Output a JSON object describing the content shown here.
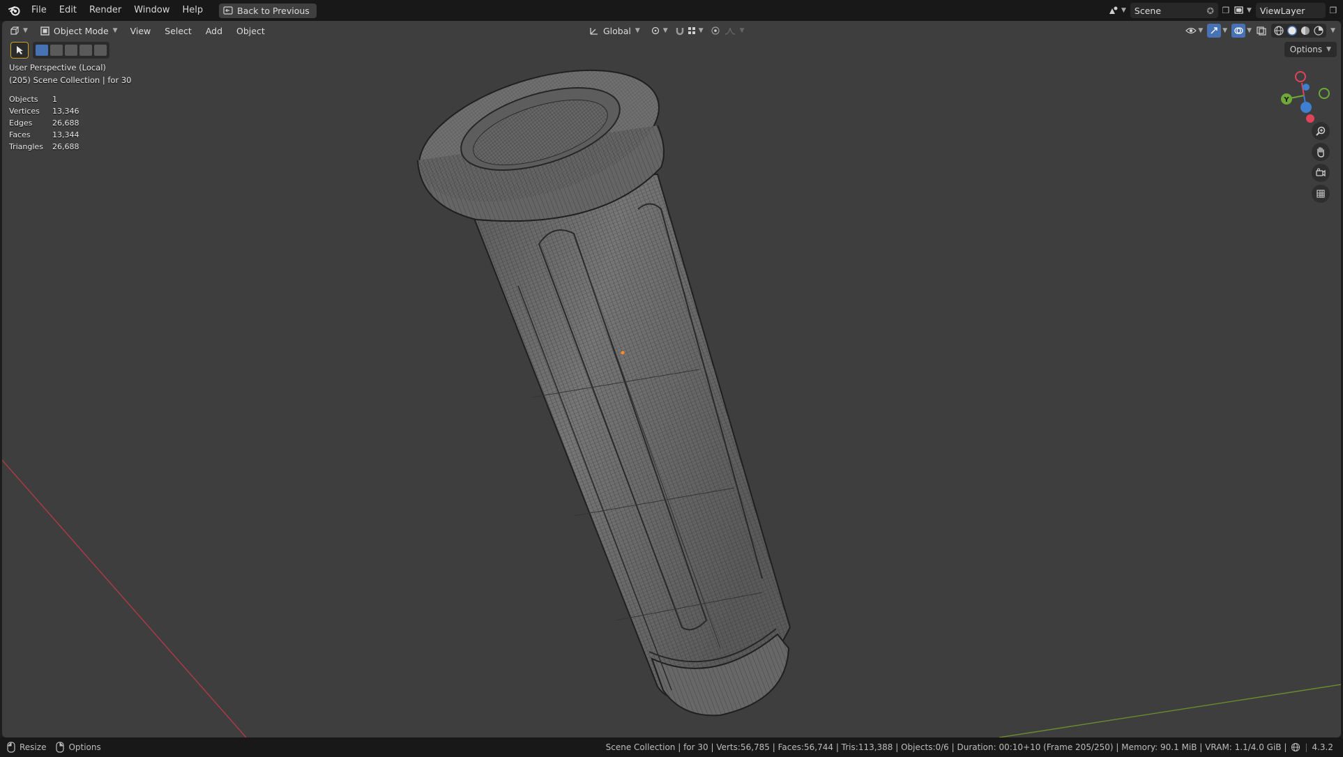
{
  "menu": {
    "items": [
      "File",
      "Edit",
      "Render",
      "Window",
      "Help"
    ],
    "back_button": "Back to Previous"
  },
  "workspace": {
    "scene_name": "Scene",
    "view_layer": "ViewLayer"
  },
  "viewport_header": {
    "mode": "Object Mode",
    "menus": [
      "View",
      "Select",
      "Add",
      "Object"
    ],
    "orientation": "Global",
    "options_label": "Options"
  },
  "overlay": {
    "perspective": "User Perspective (Local)",
    "collection": "(205) Scene Collection | for 30",
    "stats": [
      {
        "label": "Objects",
        "value": "1"
      },
      {
        "label": "Vertices",
        "value": "13,346"
      },
      {
        "label": "Edges",
        "value": "26,688"
      },
      {
        "label": "Faces",
        "value": "13,344"
      },
      {
        "label": "Triangles",
        "value": "26,688"
      }
    ]
  },
  "gizmo": {
    "x_color": "#e0445a",
    "y_color": "#6fa93a",
    "z_color": "#3f7fd0",
    "y_label": "Y"
  },
  "statusbar": {
    "left_resize": "Resize",
    "left_options": "Options",
    "info": "Scene Collection | for 30 | Verts:56,785 | Faces:56,744 | Tris:113,388 | Objects:0/6 | Duration: 00:10+10 (Frame 205/250) | Memory: 90.1 MiB | VRAM: 1.1/4.0 GiB |",
    "version": "4.3.2"
  },
  "colors": {
    "viewport_bg": "#3e3e3e",
    "mesh_fill": "#6b6b6b",
    "wire": "#2a2a2a",
    "x_axis_line": "#b03a48",
    "y_axis_line": "#6a8b2f",
    "accent": "#4772b3"
  }
}
